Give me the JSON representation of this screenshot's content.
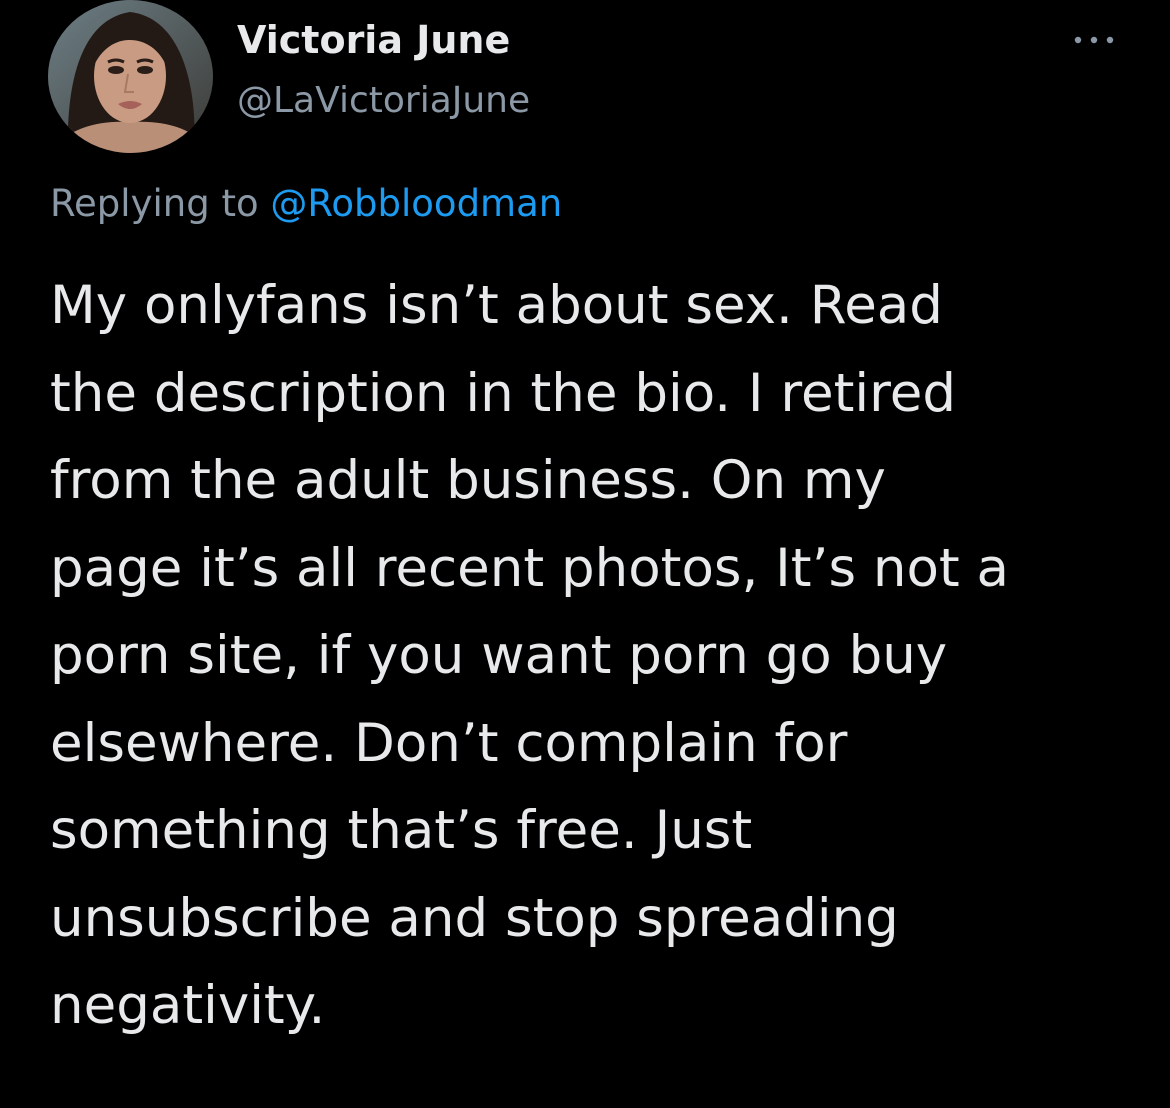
{
  "tweet": {
    "author_name": "Victoria June",
    "author_handle": "@LaVictoriaJune",
    "replying_to_prefix": "Replying to ",
    "replying_to_handle": "@Robbloodman",
    "text": "My onlyfans isn’t about sex. Read\nthe description in the bio. I retired\nfrom the adult business. On my\npage it’s all recent photos, It’s not a\nporn site, if you want porn go buy\nelsewhere. Don’t complain for\nsomething that’s free. Just\nunsubscribe and stop spreading\nnegativity."
  },
  "icons": {
    "more": "more-options-icon",
    "avatar": "profile-avatar"
  },
  "colors": {
    "background": "#000000",
    "text_primary": "#e7e9ea",
    "text_secondary": "#8b98a5",
    "link": "#1d9bf0"
  }
}
